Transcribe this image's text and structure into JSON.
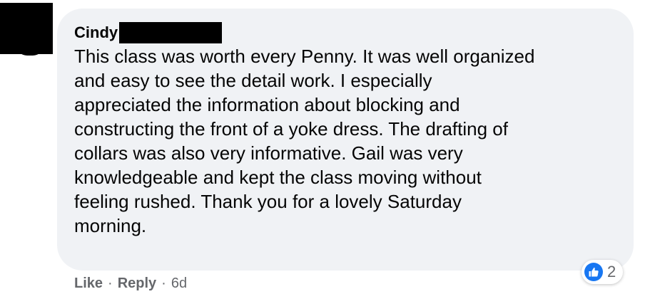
{
  "comment": {
    "author": "Cindy",
    "text_lines": [
      "This class was worth every Penny. It was well organized",
      "and easy to see the detail work. I especially",
      "appreciated the information about blocking and",
      "constructing the front of a yoke dress. The drafting of",
      "collars was also very informative. Gail was very",
      "knowledgeable and kept the class moving without",
      "feeling rushed. Thank you for a lovely Saturday",
      "morning."
    ],
    "reactions": {
      "icon": "thumbs-up-icon",
      "count": "2",
      "color": "#1877f2"
    },
    "actions": {
      "like_label": "Like",
      "separator": "·",
      "reply_label": "Reply",
      "timestamp": "6d"
    }
  },
  "colors": {
    "bubble_background": "#f0f2f5",
    "text": "#050505",
    "secondary_text": "#65676b"
  }
}
